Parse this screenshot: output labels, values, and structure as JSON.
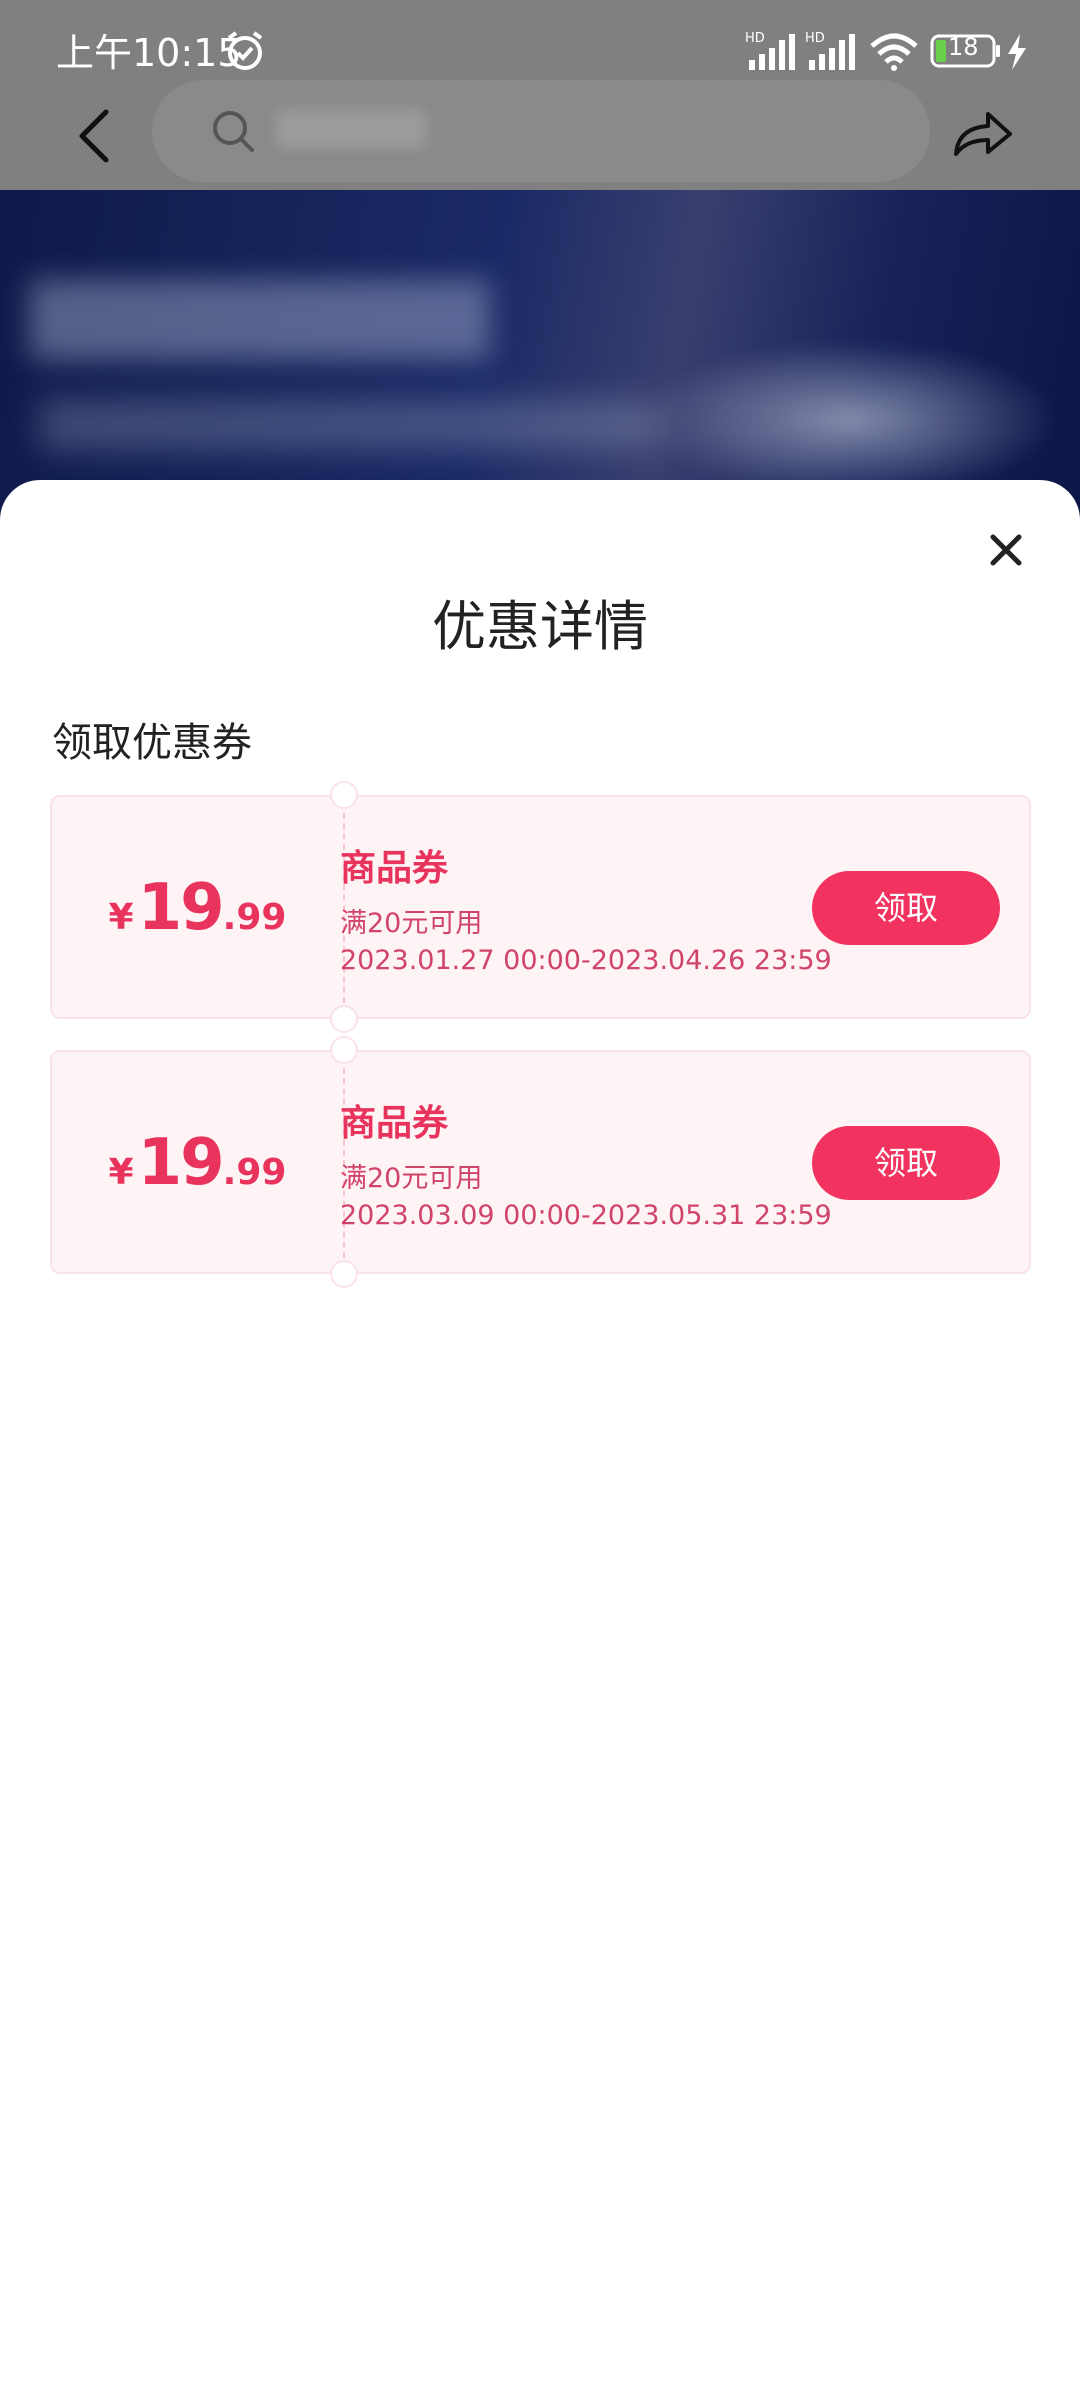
{
  "status_bar": {
    "time": "上午10:15",
    "battery": "18",
    "icons": [
      "alarm-icon",
      "signal-icon",
      "signal-icon",
      "wifi-icon",
      "battery-icon",
      "charge-icon"
    ]
  },
  "header": {
    "icons": [
      "back-icon",
      "search-icon",
      "share-icon"
    ]
  },
  "sheet": {
    "title": "优惠详情",
    "section_title": "领取优惠券",
    "close_icon": "close-icon"
  },
  "coupons": [
    {
      "currency": "¥",
      "amount_int": "19",
      "amount_dec": ".99",
      "type": "商品券",
      "condition": "满20元可用",
      "period": "2023.01.27 00:00-2023.04.26 23:59",
      "button": "领取"
    },
    {
      "currency": "¥",
      "amount_int": "19",
      "amount_dec": ".99",
      "type": "商品券",
      "condition": "满20元可用",
      "period": "2023.03.09 00:00-2023.05.31 23:59",
      "button": "领取"
    }
  ],
  "colors": {
    "accent": "#f2335f",
    "coupon_text": "#e8335d",
    "coupon_bg": "#fef4f6",
    "overlay": "#808080"
  }
}
